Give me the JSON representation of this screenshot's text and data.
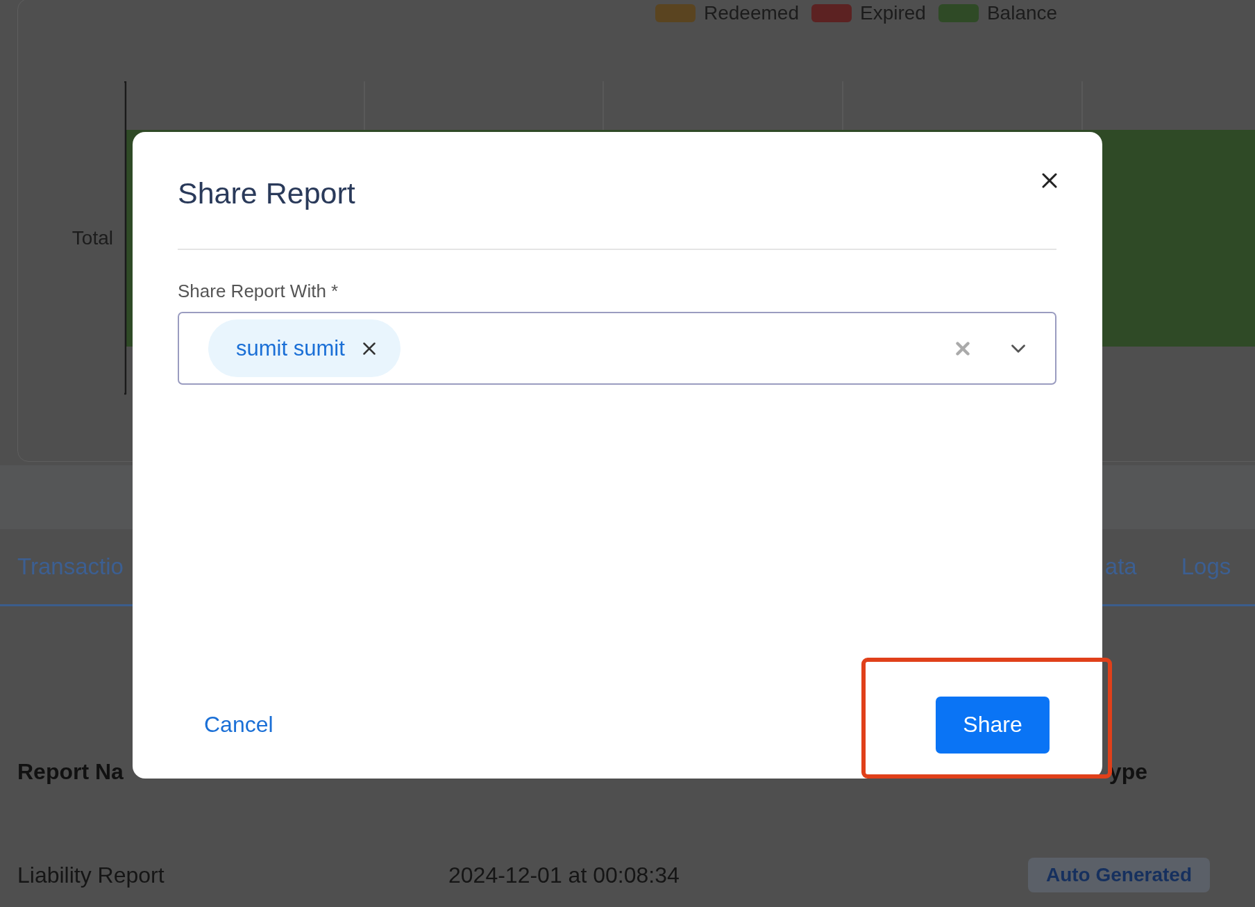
{
  "chart": {
    "legend": [
      {
        "label": "Redeemed",
        "color": "#5a4420"
      },
      {
        "label": "Expired",
        "color": "#5c2222"
      },
      {
        "label": "Balance",
        "color": "#2f4a26"
      }
    ],
    "category": "Total"
  },
  "tabs": [
    {
      "label": "Transactio"
    },
    {
      "label": "ata"
    },
    {
      "label": "Logs"
    }
  ],
  "table": {
    "columns": [
      "Report Na",
      "ype"
    ],
    "rows": [
      {
        "name": "Liability Report",
        "date": "2024-12-01 at 00:08:34",
        "type": "Auto Generated"
      }
    ]
  },
  "dialog": {
    "title": "Share Report",
    "field_label": "Share Report With *",
    "chips": [
      {
        "label": "sumit sumit"
      }
    ],
    "cancel": "Cancel",
    "confirm": "Share",
    "confirm_highlighted": true
  }
}
